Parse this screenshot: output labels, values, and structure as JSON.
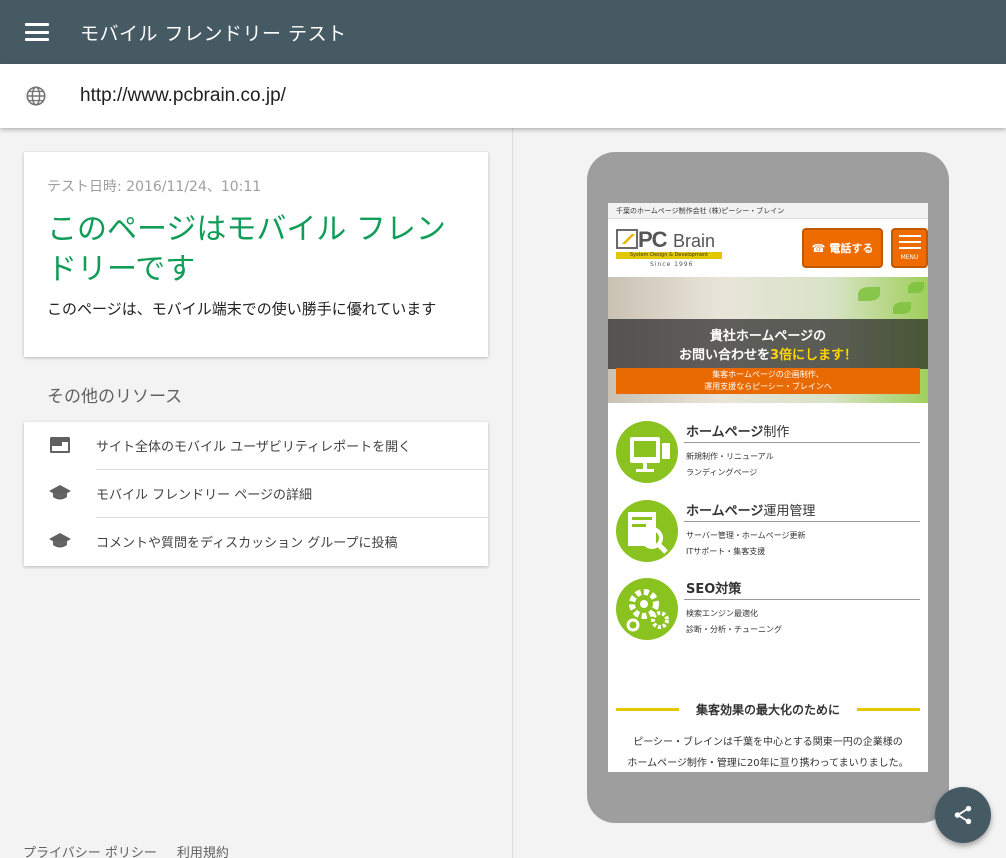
{
  "app": {
    "title": "モバイル フレンドリー テスト",
    "menu_icon": "menu-icon"
  },
  "url_bar": {
    "icon": "globe-icon",
    "url": "http://www.pcbrain.co.jp/"
  },
  "result": {
    "test_date": "テスト日時: 2016/11/24、10:11",
    "verdict": "このページはモバイル フレンドリーです",
    "verdict_color": "#109d58",
    "description": "このページは、モバイル端末での使い勝手に優れています"
  },
  "resources": {
    "title": "その他のリソース",
    "items": [
      {
        "icon": "web-report-icon",
        "label": "サイト全体のモバイル ユーザビリティレポートを開く"
      },
      {
        "icon": "school-icon",
        "label": "モバイル フレンドリー ページの詳細"
      },
      {
        "icon": "school-icon",
        "label": "コメントや質問をディスカッション グループに投稿"
      }
    ]
  },
  "footer": {
    "privacy": "プライバシー ポリシー",
    "terms": "利用規約"
  },
  "preview": {
    "topline": "千葉のホームページ制作会社 (株)ピーシー・ブレイン",
    "logo": {
      "pc": "PC",
      "brain": "Brain",
      "tagline": "System Design & Development",
      "since": "Since 1996"
    },
    "call_button": "電話する",
    "call_icon": "phone-icon",
    "menu_label": "MENU",
    "hero": {
      "line1": "貴社ホームページの",
      "line2_prefix": "お問い合わせを",
      "line2_highlight": "3倍にします！",
      "banner_line1": "集客ホームページの企画制作、",
      "banner_line2": "運用支援ならピーシー・ブレインへ"
    },
    "services": [
      {
        "icon": "monitor-icon",
        "title_bold": "ホームページ",
        "title_light": "制作",
        "line1": "新規制作・リニューアル",
        "line2": "ランディングページ"
      },
      {
        "icon": "document-search-icon",
        "title_bold": "ホームページ",
        "title_light": "運用管理",
        "line1": "サーバー管理・ホームページ更新",
        "line2": "ITサポート・集客支援"
      },
      {
        "icon": "gears-icon",
        "title_bold": "SEO対策",
        "title_light": "",
        "line1": "検索エンジン最適化",
        "line2": "診断・分析・チューニング"
      }
    ],
    "section_heading": "集客効果の最大化のために",
    "paragraph_line1": "ピーシー・ブレインは千葉を中心とする関東一円の企業様の",
    "paragraph_line2": "ホームページ制作・管理に20年に亘り携わってまいりました。"
  },
  "fab": {
    "icon": "share-icon"
  }
}
